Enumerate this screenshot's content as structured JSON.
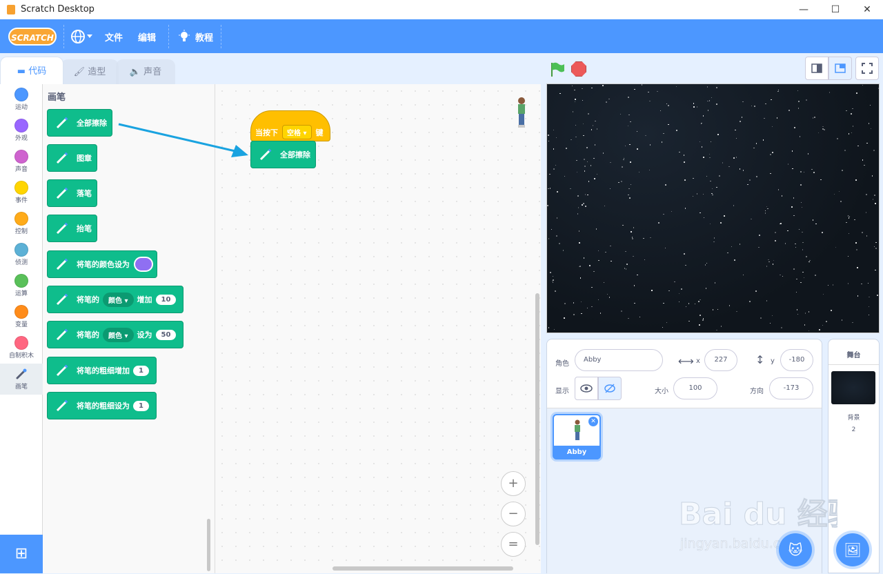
{
  "window": {
    "title": "Scratch Desktop",
    "minimize": "—",
    "maximize": "☐",
    "close": "✕"
  },
  "menubar": {
    "logo": "SCRATCH",
    "language_icon": "globe-icon",
    "file": "文件",
    "edit": "编辑",
    "tutorials": "教程"
  },
  "tabs": {
    "code": "代码",
    "costumes": "造型",
    "sounds": "声音"
  },
  "categories": [
    {
      "label": "运动",
      "color": "#4c97ff"
    },
    {
      "label": "外观",
      "color": "#9966ff"
    },
    {
      "label": "声音",
      "color": "#cf63cf"
    },
    {
      "label": "事件",
      "color": "#ffd500"
    },
    {
      "label": "控制",
      "color": "#ffab19"
    },
    {
      "label": "侦测",
      "color": "#5cb1d6"
    },
    {
      "label": "运算",
      "color": "#59c059"
    },
    {
      "label": "变量",
      "color": "#ff8c1a"
    },
    {
      "label": "自制积木",
      "color": "#ff6680"
    },
    {
      "label": "画笔",
      "color": "#0fbd8c"
    }
  ],
  "palette": {
    "title": "画笔",
    "blocks": {
      "clear": "全部擦除",
      "stamp": "图章",
      "pen_down": "落笔",
      "pen_up": "抬笔",
      "set_color": "将笔的颜色设为",
      "change_param_prefix": "将笔的",
      "change_param_dropdown": "颜色",
      "change_param_mid": "增加",
      "change_param_value": "10",
      "set_param_prefix": "将笔的",
      "set_param_dropdown": "颜色",
      "set_param_mid": "设为",
      "set_param_value": "50",
      "change_size": "将笔的粗细增加",
      "change_size_value": "1",
      "set_size": "将笔的粗细设为",
      "set_size_value": "1"
    }
  },
  "script": {
    "hat_prefix": "当按下",
    "hat_key": "空格",
    "hat_suffix": "键",
    "block": "全部擦除"
  },
  "zoom": {
    "in": "+",
    "out": "−",
    "reset": "="
  },
  "sprite_info": {
    "sprite_label": "角色",
    "sprite_name": "Abby",
    "x_label": "x",
    "x": "227",
    "y_label": "y",
    "y": "-180",
    "show_label": "显示",
    "size_label": "大小",
    "size": "100",
    "direction_label": "方向",
    "direction": "-173"
  },
  "sprites": [
    {
      "name": "Abby"
    }
  ],
  "stage_panel": {
    "title": "舞台",
    "backdrops_label": "背景",
    "backdrops_count": "2"
  },
  "watermark": {
    "text": "Bai du 经验",
    "url": "jingyan.baidu.com"
  }
}
